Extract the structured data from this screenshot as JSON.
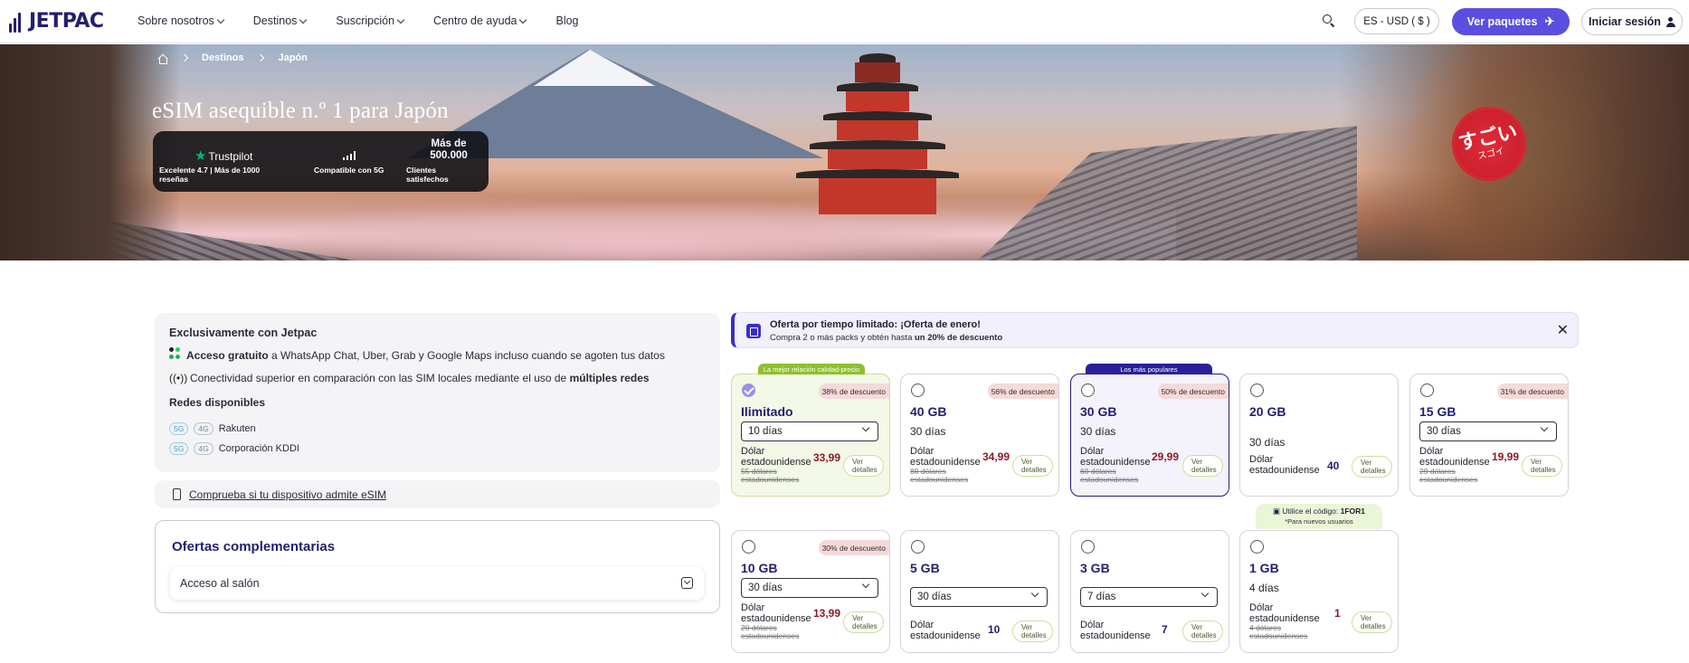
{
  "header": {
    "logo": "JETPAC",
    "nav": [
      "Sobre nosotros",
      "Destinos",
      "Suscripción",
      "Centro de ayuda",
      "Blog"
    ],
    "lang": "ES - USD ( $ )",
    "cta": "Ver paquetes",
    "login": "Iniciar sesión"
  },
  "hero": {
    "breadcrumb": [
      "Destinos",
      "Japón"
    ],
    "title": "eSIM asequible n.º 1 para Japón",
    "trustpilot": {
      "logo": "Trustpilot",
      "text": "Excelente 4.7 | Más de 1000 reseñas"
    },
    "compat": "Compatible con 5G",
    "clients_num": "Más de 500.000",
    "clients_text": "Clientes satisfechos",
    "badge_big": "すごい",
    "badge_small": "スゴイ"
  },
  "left": {
    "exclusive_title": "Exclusivamente con Jetpac",
    "free_access_bold": "Acceso gratuito",
    "free_access_rest": " a WhatsApp Chat, Uber, Grab y Google Maps incluso cuando se agoten tus datos",
    "connectivity_text": "Conectividad superior en comparación con las SIM locales mediante el uso de ",
    "connectivity_bold": "múltiples redes",
    "networks_title": "Redes disponibles",
    "networks": [
      {
        "g5": "5G",
        "g4": "4G",
        "name": "Rakuten"
      },
      {
        "g5": "5G",
        "g4": "4G",
        "name": "Corporación KDDI"
      }
    ],
    "compat_link": "Comprueba si tu dispositivo admite eSIM",
    "extras_title": "Ofertas complementarias",
    "lounge": "Acceso al salón"
  },
  "offer": {
    "title": "Oferta por tiempo limitado: ¡Oferta de enero!",
    "sub_pre": "Compra 2 o más packs y obtén hasta ",
    "sub_bold": "un 20% de descuento",
    "close": "✕"
  },
  "plans": [
    {
      "name": "Ilimitado",
      "days": "10 días",
      "disc": "38% de descuento",
      "cur": "Dólar estadounidense",
      "price": "33,99",
      "old": "55 dólares estadounidenses",
      "details": "Ver detalles",
      "tag": "La mejor relación calidad-precio"
    },
    {
      "name": "40 GB",
      "days": "30 días",
      "disc": "56% de descuento",
      "cur": "Dólar estadounidense",
      "price": "34,99",
      "old": "80 dólares estadounidenses",
      "details": "Ver detalles"
    },
    {
      "name": "30 GB",
      "days": "30 días",
      "disc": "50% de descuento",
      "cur": "Dólar estadounidense",
      "price": "29,99",
      "old": "60 dólares estadounidenses",
      "details": "Ver detalles",
      "tag": "Los más populares"
    },
    {
      "name": "20 GB",
      "days": "30 días",
      "cur": "Dólar estadounidense",
      "price": "40",
      "details": "Ver detalles"
    },
    {
      "name": "15 GB",
      "days": "30 días",
      "disc": "31% de descuento",
      "cur": "Dólar estadounidense",
      "price": "19,99",
      "old": "29 dólares estadounidenses",
      "details": "Ver detalles"
    },
    {
      "name": "10 GB",
      "days": "30 días",
      "disc": "30% de descuento",
      "cur": "Dólar estadounidense",
      "price": "13,99",
      "old": "20 dólares estadounidenses",
      "details": "Ver detalles"
    },
    {
      "name": "5 GB",
      "days": "30 días",
      "cur": "Dólar estadounidense",
      "price": "10",
      "details": "Ver detalles"
    },
    {
      "name": "3 GB",
      "days": "7 días",
      "cur": "Dólar estadounidense",
      "price": "7",
      "details": "Ver detalles"
    },
    {
      "name": "1 GB",
      "days": "4 días",
      "cur": "Dólar estadounidense",
      "price": "1",
      "old": "4 dólares estadounidenses",
      "details": "Ver detalles"
    }
  ],
  "code_tag": {
    "pre": "Utilice el código: ",
    "code": "1FOR1",
    "note": "*Para nuevos usuarios"
  }
}
